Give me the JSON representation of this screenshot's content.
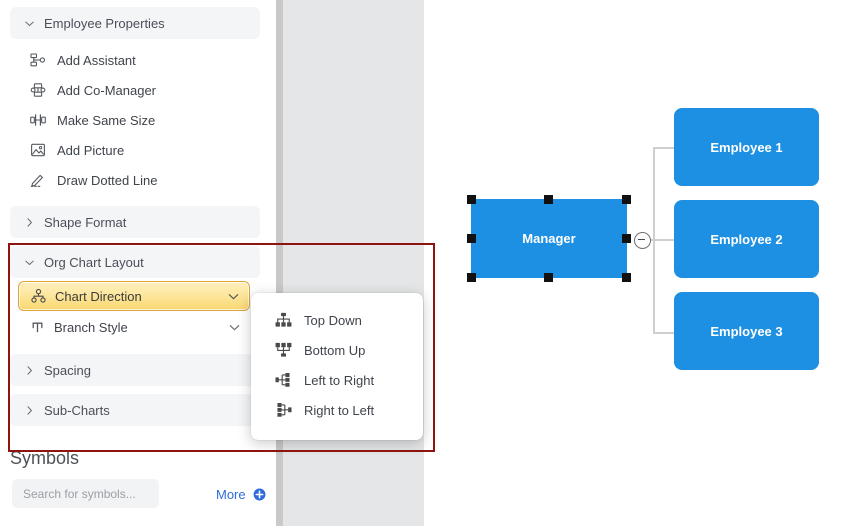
{
  "panel": {
    "sections": [
      {
        "id": "employee-properties",
        "label": "Employee Properties",
        "state": "expanded",
        "chevron": "chevron-down-icon"
      },
      {
        "id": "shape-format",
        "label": "Shape Format",
        "state": "collapsed",
        "chevron": "chevron-right-icon"
      },
      {
        "id": "org-chart-layout",
        "label": "Org Chart Layout",
        "state": "expanded",
        "chevron": "chevron-down-icon"
      },
      {
        "id": "spacing",
        "label": "Spacing",
        "state": "collapsed",
        "chevron": "chevron-right-icon"
      },
      {
        "id": "sub-charts",
        "label": "Sub-Charts",
        "state": "collapsed",
        "chevron": "chevron-right-icon"
      }
    ],
    "employee_properties_items": [
      {
        "label": "Add Assistant",
        "icon": "add-assistant-icon"
      },
      {
        "label": "Add Co-Manager",
        "icon": "add-co-manager-icon"
      },
      {
        "label": "Make Same Size",
        "icon": "make-same-size-icon"
      },
      {
        "label": "Add Picture",
        "icon": "add-picture-icon"
      },
      {
        "label": "Draw Dotted Line",
        "icon": "draw-dotted-line-icon"
      }
    ],
    "org_chart_layout_items": [
      {
        "label": "Chart Direction",
        "icon": "org-chart-icon",
        "selected": true,
        "caret": "chevron-down-icon"
      },
      {
        "label": "Branch Style",
        "icon": "branch-style-icon",
        "selected": false,
        "caret": "chevron-down-icon"
      }
    ]
  },
  "flyout": {
    "name": "chart-direction-menu",
    "items": [
      {
        "label": "Top Down",
        "icon": "top-down-icon"
      },
      {
        "label": "Bottom Up",
        "icon": "bottom-up-icon"
      },
      {
        "label": "Left to Right",
        "icon": "left-to-right-icon"
      },
      {
        "label": "Right to Left",
        "icon": "right-to-left-icon"
      }
    ]
  },
  "symbols": {
    "title": "Symbols",
    "search_value": "",
    "search_placeholder": "Search for symbols...",
    "search_icon": "search-icon",
    "more_label": "More",
    "more_icon": "plus-circle-icon"
  },
  "chart": {
    "root": {
      "label": "Manager",
      "selected": true
    },
    "children": [
      {
        "label": "Employee 1"
      },
      {
        "label": "Employee 2"
      },
      {
        "label": "Employee 3"
      }
    ],
    "collapse_control": "collapse-minus-button"
  },
  "colors": {
    "node_blue": "#1e90e3",
    "highlight_amber": "#f9d870",
    "annotation_red": "#8e1410",
    "link_blue": "#2f6bdd",
    "connector_gray": "#cfcfcf",
    "handle_black": "#111111"
  }
}
